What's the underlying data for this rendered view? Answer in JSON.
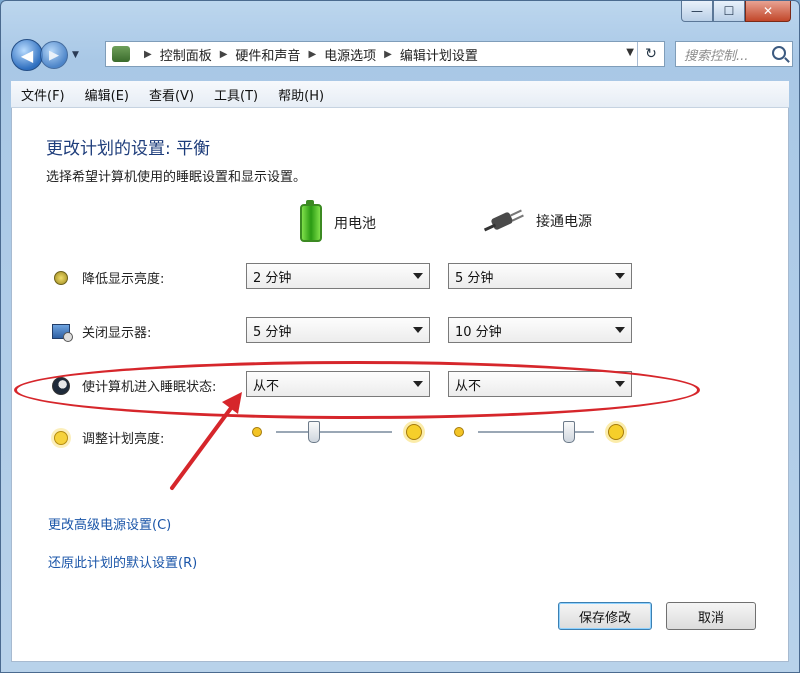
{
  "window": {
    "caption_buttons": {
      "minimize": "—",
      "maximize": "☐",
      "close": "✕"
    }
  },
  "nav": {
    "breadcrumbs": [
      "控制面板",
      "硬件和声音",
      "电源选项",
      "编辑计划设置"
    ],
    "search_placeholder": "搜索控制..."
  },
  "menubar": [
    "文件(F)",
    "编辑(E)",
    "查看(V)",
    "工具(T)",
    "帮助(H)"
  ],
  "page": {
    "title": "更改计划的设置: 平衡",
    "subtitle": "选择希望计算机使用的睡眠设置和显示设置。",
    "col_battery": "用电池",
    "col_plugged": "接通电源"
  },
  "rows": [
    {
      "label": "降低显示亮度:",
      "battery": "2 分钟",
      "plugged": "5 分钟"
    },
    {
      "label": "关闭显示器:",
      "battery": "5 分钟",
      "plugged": "10 分钟"
    },
    {
      "label": "使计算机进入睡眠状态:",
      "battery": "从不",
      "plugged": "从不"
    }
  ],
  "brightness": {
    "label": "调整计划亮度:",
    "battery_level": 0.3,
    "plugged_level": 0.8
  },
  "links": {
    "advanced": "更改高级电源设置(C)",
    "restore": "还原此计划的默认设置(R)"
  },
  "buttons": {
    "save": "保存修改",
    "cancel": "取消"
  },
  "icons": {
    "dim": "sun-small-icon",
    "display_off": "monitor-icon",
    "sleep": "moon-icon",
    "brightness": "sun-icon",
    "battery": "battery-icon",
    "plugged": "power-plug-icon"
  },
  "accent_colors": {
    "title": "#1e3d7b",
    "link": "#1a55a8",
    "annotation": "#d6262b"
  }
}
